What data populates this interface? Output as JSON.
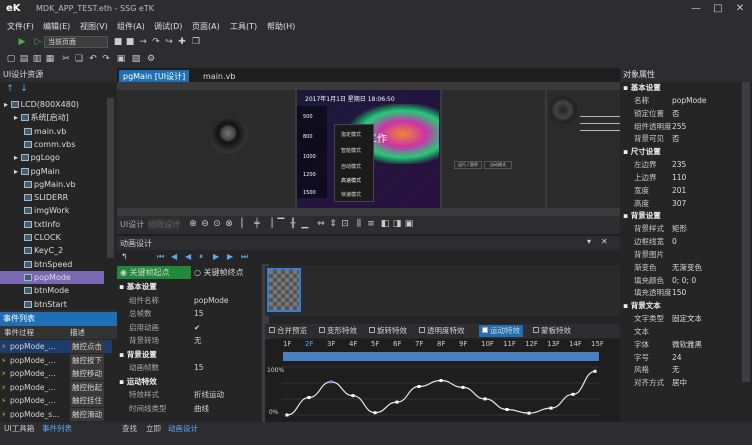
{
  "window": {
    "title": "MDK_APP_TEST.eth - SSG eTK",
    "logo": "eK",
    "min": "—",
    "max": "□",
    "close": "✕"
  },
  "menu": [
    "文件(F)",
    "编辑(E)",
    "视图(V)",
    "组件(A)",
    "调试(D)",
    "页面(A)",
    "工具(T)",
    "帮助(H)"
  ],
  "toolbar": {
    "page_combo": "当前页面"
  },
  "left_panel": {
    "title": "UI设计资源",
    "items": [
      {
        "label": "LCD(800X480)",
        "level": 0
      },
      {
        "label": "系统[启动]",
        "level": 1
      },
      {
        "label": "main.vb",
        "level": 2
      },
      {
        "label": "comm.vbs",
        "level": 2
      },
      {
        "label": "pgLogo",
        "level": 1
      },
      {
        "label": "pgMain",
        "level": 1
      },
      {
        "label": "pgMain.vb",
        "level": 2
      },
      {
        "label": "SLIDERR",
        "level": 2
      },
      {
        "label": "imgWork",
        "level": 2
      },
      {
        "label": "txtInfo",
        "level": 2
      },
      {
        "label": "CLOCK",
        "level": 2
      },
      {
        "label": "KeyC_2",
        "level": 2
      },
      {
        "label": "btnSpeed",
        "level": 2
      },
      {
        "label": "popMode",
        "level": 2,
        "selected": true
      },
      {
        "label": "btnMode",
        "level": 2
      },
      {
        "label": "btnStart",
        "level": 2
      }
    ]
  },
  "events": {
    "title": "事件列表",
    "col1": "事件过程",
    "col2": "描述",
    "rows": [
      [
        "popMode_...",
        "触控点击"
      ],
      [
        "popMode_...",
        "触控按下"
      ],
      [
        "popMode_...",
        "触控移动"
      ],
      [
        "popMode_...",
        "触控抬起"
      ],
      [
        "popMode_...",
        "触控挂住"
      ],
      [
        "popMode_s...",
        "触控滑动"
      ]
    ]
  },
  "doc_tabs": [
    "pgMain [UI设计]",
    "main.vb"
  ],
  "canvas": {
    "status": "2017年1月1日 星期日 18:06:50",
    "menu": [
      "500",
      "800",
      "1000",
      "1200",
      "1500"
    ],
    "popup": [
      "指定模式",
      "智能模式",
      "自动模式",
      "高速模式",
      "快速模式"
    ],
    "btn1": "运行 / 暂停",
    "btn2": "自动模式",
    "wm": "依马工作"
  },
  "view_tabs": [
    "UI设计",
    "动效设计"
  ],
  "anim": {
    "title": "动画设计",
    "kf_start": "关键帧起点",
    "kf_end": "关键帧终点",
    "basic_title": "基本设置",
    "basic": [
      [
        "组件名称",
        "popMode"
      ],
      [
        "总帧数",
        "15"
      ],
      [
        "启用动画",
        "✔"
      ],
      [
        "背景转场",
        "无"
      ]
    ],
    "bg_title": "背景设置",
    "bg": [
      [
        "动画帧数",
        "15"
      ]
    ],
    "motion_title": "运动特效",
    "motion": [
      [
        "特效样式",
        "折线运动"
      ],
      [
        "时间线类型",
        "曲线"
      ]
    ],
    "fx_tabs": [
      "合并预览",
      "变形特效",
      "旋转特效",
      "透明度特效",
      "运动特效",
      "蒙板特效"
    ],
    "frames": [
      "1F",
      "2F",
      "3F",
      "4F",
      "5F",
      "6F",
      "7F",
      "8F",
      "9F",
      "10F",
      "11F",
      "12F",
      "13F",
      "14F",
      "15F"
    ],
    "y_top": "100%",
    "y_bot": "0%",
    "curve": [
      0,
      0.38,
      0.72,
      0.42,
      0.05,
      0.28,
      0.62,
      0.75,
      0.6,
      0.35,
      0.12,
      0.04,
      0.15,
      0.45,
      0.95
    ]
  },
  "props": {
    "title": "对象属性",
    "sections": [
      {
        "name": "基本设置",
        "rows": [
          [
            "名称",
            "popMode"
          ],
          [
            "锁定位置",
            "否"
          ],
          [
            "组件透明度",
            "255"
          ],
          [
            "背景可见",
            "否"
          ]
        ]
      },
      {
        "name": "尺寸设置",
        "rows": [
          [
            "左边界",
            "235"
          ],
          [
            "上边界",
            "110"
          ],
          [
            "宽度",
            "201"
          ],
          [
            "高度",
            "307"
          ]
        ]
      },
      {
        "name": "背景设置",
        "rows": [
          [
            "背景样式",
            "矩形"
          ],
          [
            "边框线宽",
            "0"
          ],
          [
            "背景图片",
            ""
          ],
          [
            "渐变色",
            "无渐变色"
          ],
          [
            "填充颜色",
            "0; 0; 0"
          ],
          [
            "填充透明度",
            "150"
          ]
        ]
      },
      {
        "name": "背景文本",
        "rows": [
          [
            "文字类型",
            "固定文本"
          ],
          [
            "文本",
            ""
          ],
          [
            "字体",
            "微软雅黑"
          ],
          [
            "字号",
            "24"
          ],
          [
            "风格",
            "无"
          ],
          [
            "对齐方式",
            "居中"
          ]
        ]
      }
    ]
  },
  "status_left": [
    "UI工具箱",
    "事件列表"
  ],
  "status_mid": [
    "查找",
    "立即",
    "动画设计"
  ],
  "colors": {
    "accent": "#1f6fb5",
    "select": "#7b68b5",
    "curve": "#e8e8e8"
  }
}
